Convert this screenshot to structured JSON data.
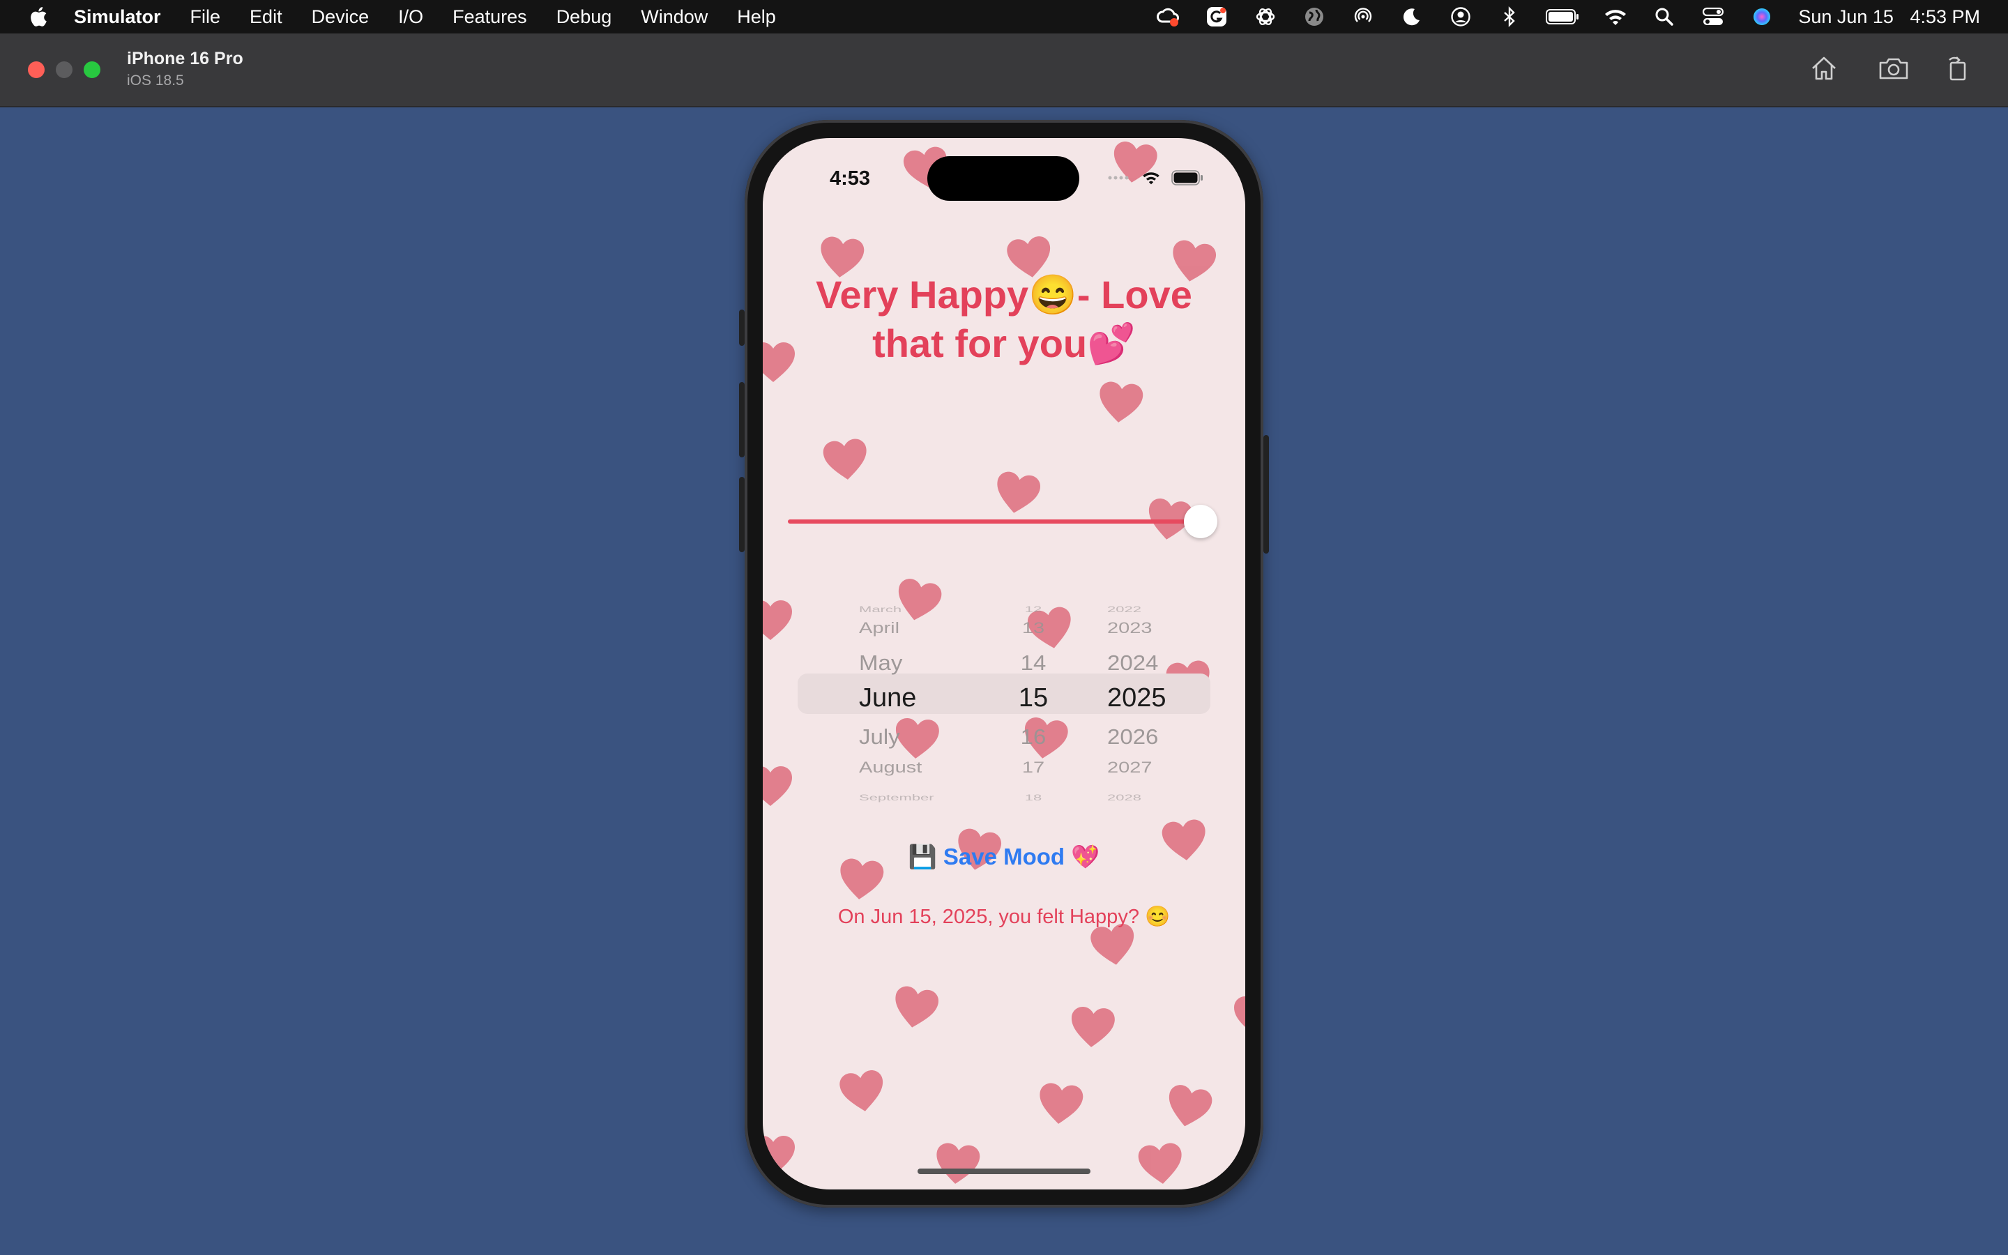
{
  "menubar": {
    "app_name": "Simulator",
    "items": [
      "File",
      "Edit",
      "Device",
      "I/O",
      "Features",
      "Debug",
      "Window",
      "Help"
    ],
    "date": "Sun Jun 15",
    "time": "4:53 PM"
  },
  "window": {
    "device_name": "iPhone 16 Pro",
    "os_version": "iOS 18.5"
  },
  "phone": {
    "status_time": "4:53",
    "mood_title": "Very Happy😄- Love that for you💕",
    "mood_slider_value": 1.0,
    "picker": {
      "rows": [
        {
          "month": "March",
          "day": "12",
          "year": "2022"
        },
        {
          "month": "April",
          "day": "13",
          "year": "2023"
        },
        {
          "month": "May",
          "day": "14",
          "year": "2024"
        },
        {
          "month": "June",
          "day": "15",
          "year": "2025"
        },
        {
          "month": "July",
          "day": "16",
          "year": "2026"
        },
        {
          "month": "August",
          "day": "17",
          "year": "2027"
        },
        {
          "month": "September",
          "day": "18",
          "year": "2028"
        }
      ],
      "selected_index": 3
    },
    "save_button": {
      "icon": "💾",
      "label": "Save Mood",
      "trailing_icon": "💖"
    },
    "summary_text": "On Jun 15, 2025, you felt Happy? 😊"
  },
  "colors": {
    "accent": "#e3415a",
    "link": "#2f7bf1",
    "background": "#f4e6e7",
    "desktop": "#3a5380"
  }
}
